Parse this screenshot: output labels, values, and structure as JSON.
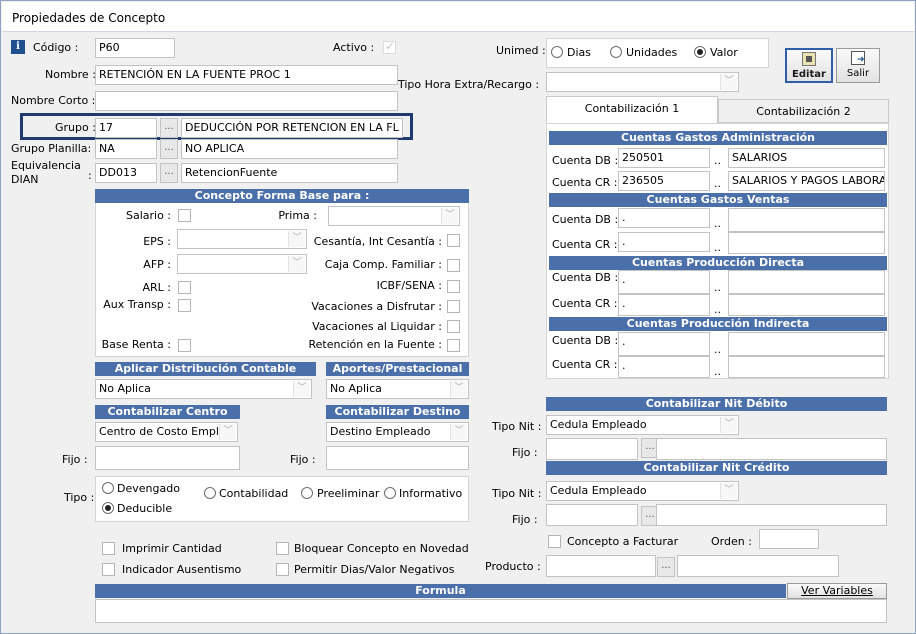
{
  "window": {
    "title": "Propiedades de Concepto"
  },
  "info_icon": "i",
  "fields": {
    "codigo": {
      "label": "Código :",
      "value": "P60"
    },
    "activo": {
      "label": "Activo :"
    },
    "nombre": {
      "label": "Nombre :",
      "value": "RETENCIÓN EN LA FUENTE PROC 1"
    },
    "nombre_corto": {
      "label": "Nombre Corto :",
      "value": ""
    },
    "grupo": {
      "label": "Grupo :",
      "code": "17",
      "desc": "DEDUCCIÓN POR RETENCION EN LA FL"
    },
    "grupo_planilla": {
      "label": "Grupo Planilla:",
      "code": "NA",
      "desc": "NO APLICA"
    },
    "equivalencia": {
      "label1": "Equivalencia",
      "label2": ":",
      "label3": "DIAN",
      "code": "DD013",
      "desc": "RetencionFuente"
    }
  },
  "unimed": {
    "label": "Unimed :",
    "options": [
      "Dias",
      "Unidades",
      "Valor"
    ]
  },
  "tipo_hora": {
    "label": "Tipo Hora Extra/Recargo :"
  },
  "buttons": {
    "editar": "Editar",
    "salir": "Salir",
    "dots": "...",
    "ver_variables": "Ver Variables"
  },
  "base": {
    "title": "Concepto Forma Base para :",
    "salario": "Salario :",
    "prima": "Prima :",
    "eps": "EPS :",
    "cesantia": "Cesantía, Int Cesantía :",
    "afp": "AFP :",
    "caja": "Caja Comp. Familiar :",
    "arl": "ARL :",
    "icbf": "ICBF/SENA :",
    "aux": "Aux Transp :",
    "vac_disfrutar": "Vacaciones a Disfrutar :",
    "vac_liquidar": "Vacaciones al Liquidar :",
    "base_renta": "Base Renta :",
    "retencion": "Retención en la Fuente :"
  },
  "distribucion": {
    "title": "Aplicar Distribución Contable",
    "value": "No Aplica"
  },
  "aportes": {
    "title": "Aportes/Prestacional",
    "value": "No Aplica"
  },
  "centro": {
    "title": "Contabilizar Centro",
    "value": "Centro de Costo Emple"
  },
  "destino": {
    "title": "Contabilizar Destino",
    "value": "Destino Empleado"
  },
  "fijo": "Fijo :",
  "tipo": {
    "label": "Tipo :",
    "options": [
      "Devengado",
      "Contabilidad",
      "Preeliminar",
      "Informativo",
      "Deducible"
    ]
  },
  "checks": {
    "imprimir": "Imprimir Cantidad",
    "bloquear": "Bloquear Concepto en Novedad",
    "ausentismo": "Indicador Ausentismo",
    "permitir": "Permitir Dias/Valor Negativos"
  },
  "tabs": [
    "Contabilización 1",
    "Contabilización 2"
  ],
  "cuentas": {
    "db": "Cuenta DB :",
    "cr": "Cuenta CR :",
    "admin": {
      "title": "Cuentas Gastos Administración",
      "db_code": "250501",
      "db_name": "SALARIOS",
      "cr_code": "236505",
      "cr_name": "SALARIOS Y PAGOS LABORA"
    },
    "ventas": {
      "title": "Cuentas Gastos Ventas"
    },
    "prod_dir": {
      "title": "Cuentas Producción Directa"
    },
    "prod_ind": {
      "title": "Cuentas Producción Indirecta"
    },
    "empty": ".",
    "sep": ".."
  },
  "nit_debito": {
    "title": "Contabilizar Nit Débito",
    "tipo_label": "Tipo Nit :",
    "tipo_value": "Cedula Empleado",
    "fijo": "Fijo :"
  },
  "nit_credito": {
    "title": "Contabilizar Nit Crédito",
    "tipo_label": "Tipo Nit :",
    "tipo_value": "Cedula Empleado",
    "fijo": "Fijo :"
  },
  "facturar": {
    "label": "Concepto a Facturar",
    "orden": "Orden :",
    "producto": "Producto :"
  },
  "formula": {
    "title": "Formula"
  },
  "colors": {
    "header_blue": "#4b6fa8",
    "highlight": "#1f3a6e"
  }
}
